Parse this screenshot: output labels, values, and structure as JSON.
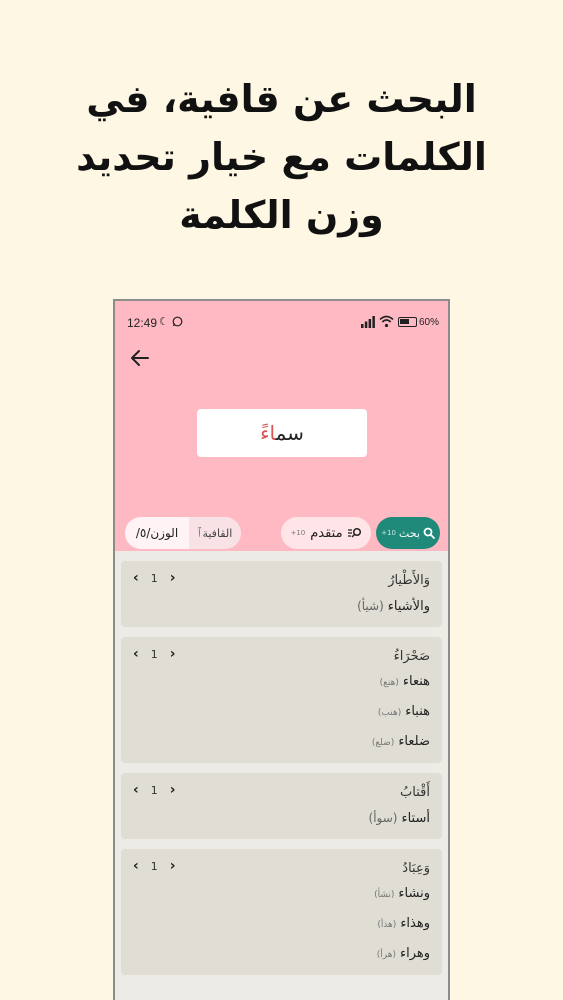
{
  "headline": {
    "line1": "البحث عن قافية، في",
    "line2": "الكلمات مع خيار تحديد",
    "line3": "وزن الكلمة"
  },
  "status_bar": {
    "time": "12:49",
    "battery": "60",
    "battery_level": 0.6,
    "icons": [
      "moon-icon",
      "whatsapp-icon",
      "signal-icon",
      "wifi-icon",
      "battery-icon"
    ]
  },
  "search": {
    "word_prefix": "سم",
    "word_highlight": "اءً",
    "search_label": "بحث",
    "search_sub": "10+",
    "advanced_label": "متقدم",
    "advanced_sub": "10+",
    "rhyme_toggle_label": "القافية",
    "meter_toggle_label": "الوزن/٥/"
  },
  "results": [
    {
      "heading": "وَالأَطْيارُ",
      "page": "1",
      "rhymes": [
        {
          "word": "والأشياء",
          "root": "(شيأ)",
          "root_style": "big"
        }
      ]
    },
    {
      "heading": "صَحْرَاءُ",
      "page": "1",
      "rhymes": [
        {
          "word": "هنعاء",
          "root": "(هنع)",
          "root_style": "small"
        },
        {
          "word": "هنباء",
          "root": "(هنب)",
          "root_style": "small"
        },
        {
          "word": "ضلعاء",
          "root": "(ضلع)",
          "root_style": "small"
        }
      ]
    },
    {
      "heading": "أَقْتابُ",
      "page": "1",
      "rhymes": [
        {
          "word": "أستاء",
          "root": "(سوأ)",
          "root_style": "big"
        }
      ]
    },
    {
      "heading": "وَعِبَادُ",
      "page": "1",
      "rhymes": [
        {
          "word": "ونشاء",
          "root": "(نشأ)",
          "root_style": "small"
        },
        {
          "word": "وهذاء",
          "root": "(هذأ)",
          "root_style": "small"
        },
        {
          "word": "وهراء",
          "root": "(هرأ)",
          "root_style": "small"
        }
      ]
    }
  ],
  "colors": {
    "page_background": "#fdf7e4",
    "header_pink": "#ffb9c3",
    "search_button": "#1f8a7a",
    "highlight_red": "#d9534f",
    "card_background": "#e0ddd4"
  }
}
